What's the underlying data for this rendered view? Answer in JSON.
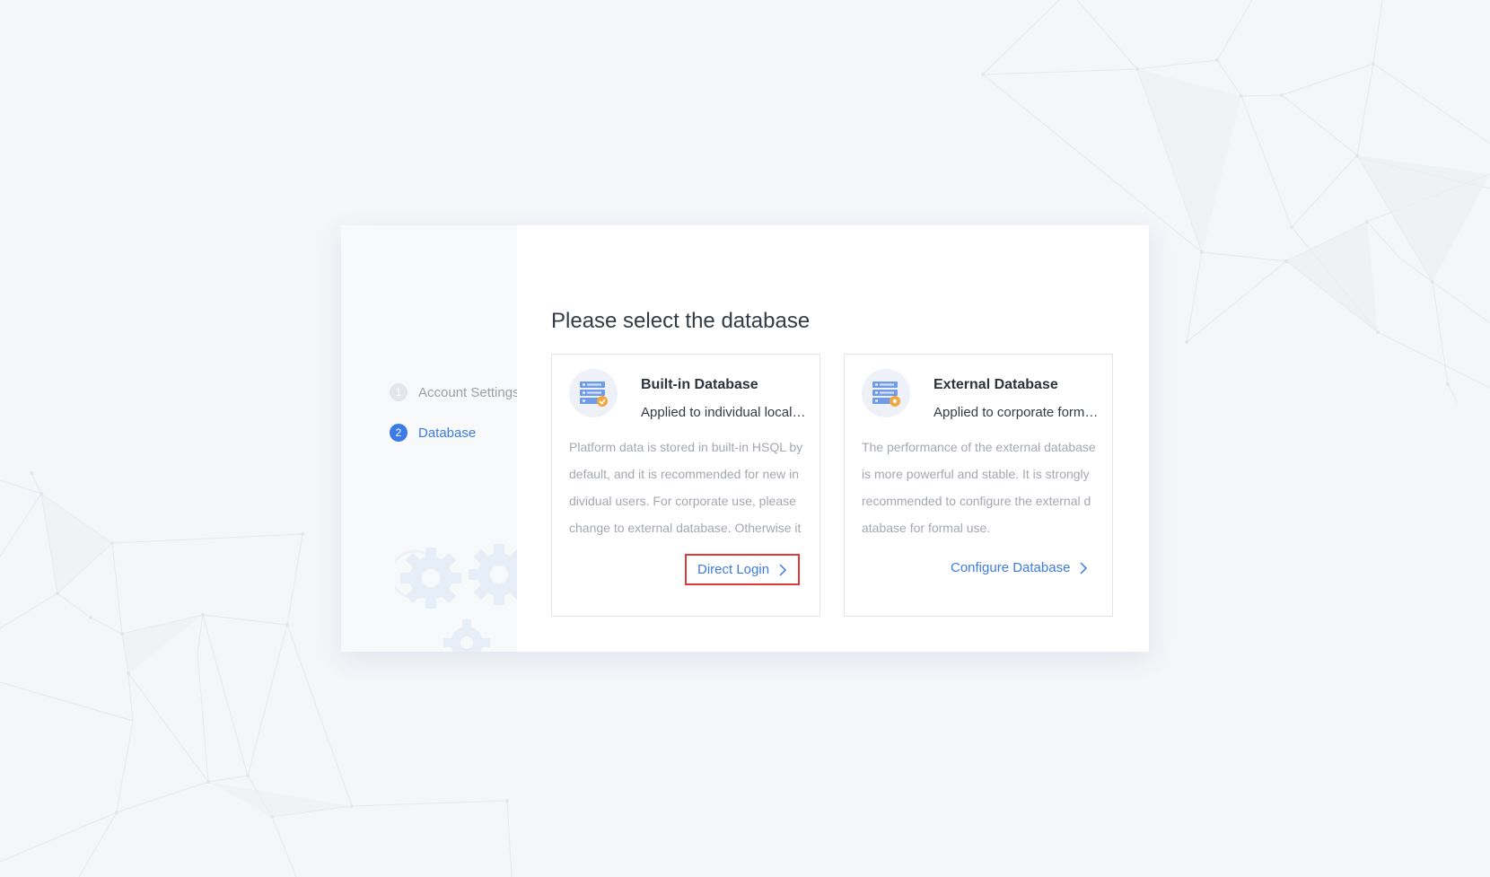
{
  "steps": [
    {
      "number": "1",
      "label": "Account Settings",
      "state": "done"
    },
    {
      "number": "2",
      "label": "Database",
      "state": "active"
    }
  ],
  "main": {
    "title": "Please select the database",
    "cards": [
      {
        "name": "Built-in Database",
        "subtitle": "Applied to individual local testing",
        "description": "Platform data is stored in built-in HSQL by default, and it is recommended for new individual users. For corporate use, please change to external database. Otherwise it may cause performance and stability problems.",
        "action": "Direct Login",
        "icon": "database-check-icon"
      },
      {
        "name": "External Database",
        "subtitle": "Applied to corporate formal use",
        "description": "The performance of the external database is more powerful and stable. It is strongly recommended to configure the external database for formal use.",
        "action": "Configure Database",
        "icon": "database-gear-icon"
      }
    ]
  },
  "colors": {
    "accent": "#3c7be6",
    "highlight_border": "#e0393a",
    "muted_text": "#a3a8b0",
    "background": "#f4f6f9"
  }
}
